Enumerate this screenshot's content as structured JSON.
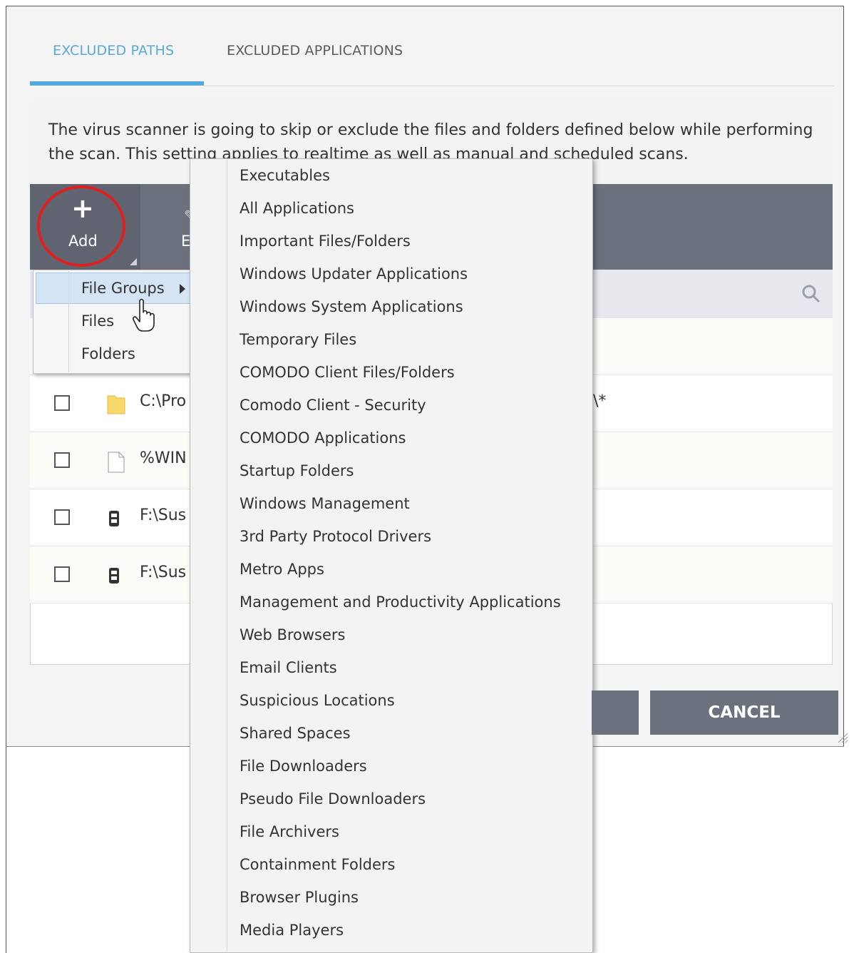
{
  "tabs": {
    "excluded_paths": "EXCLUDED PATHS",
    "excluded_applications": "EXCLUDED APPLICATIONS"
  },
  "description": "The virus scanner is going to skip or exclude the files and folders defined below while performing the scan. This setting applies to realtime as well as manual and scheduled scans.",
  "toolbar": {
    "add_label": "Add",
    "edit_label": "E"
  },
  "add_menu": {
    "items": [
      "File Groups",
      "Files",
      "Folders"
    ]
  },
  "rows": [
    {
      "path": "C:\\Pro",
      "suffix": "\\*",
      "icon": "folder-icon"
    },
    {
      "path": "%WIN",
      "suffix": "",
      "icon": "file-icon"
    },
    {
      "path": "F:\\Sus",
      "suffix": "",
      "icon": "executable-icon"
    },
    {
      "path": "F:\\Sus",
      "suffix": "",
      "icon": "executable-icon"
    }
  ],
  "file_groups_menu": {
    "items": [
      "Executables",
      "All Applications",
      "Important Files/Folders",
      "Windows Updater Applications",
      "Windows System Applications",
      "Temporary Files",
      "COMODO Client Files/Folders",
      "Comodo Client - Security",
      "COMODO Applications",
      "Startup Folders",
      "Windows Management",
      "3rd Party Protocol Drivers",
      "Metro Apps",
      "Management and Productivity Applications",
      "Web Browsers",
      "Email Clients",
      "Suspicious Locations",
      "Shared Spaces",
      "File Downloaders",
      "Pseudo File Downloaders",
      "File Archivers",
      "Containment Folders",
      "Browser Plugins",
      "Media Players"
    ]
  },
  "buttons": {
    "cancel": "CANCEL"
  },
  "colors": {
    "accent": "#55aadd",
    "toolbar": "#6c717e",
    "highlight_circle": "#e02020"
  }
}
